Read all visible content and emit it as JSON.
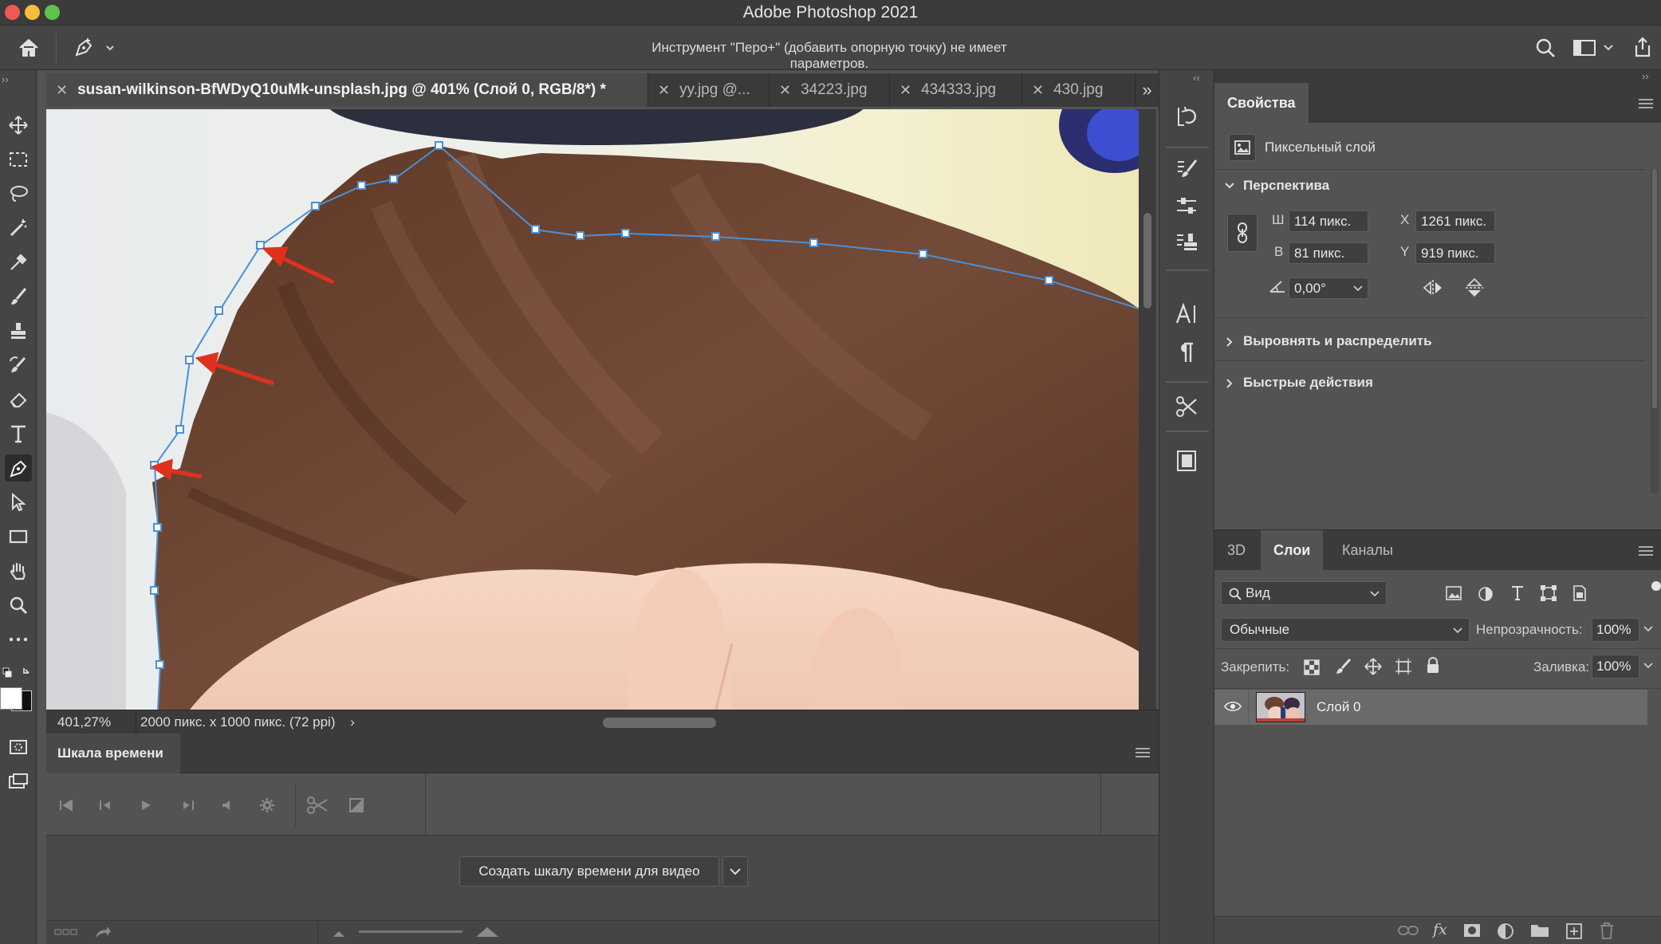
{
  "window": {
    "title": "Adobe Photoshop 2021"
  },
  "options_bar": {
    "message": "Инструмент \"Перо+\" (добавить опорную точку) не имеет параметров."
  },
  "tabs": [
    {
      "label": "susan-wilkinson-BfWDyQ10uMk-unsplash.jpg @ 401% (Слой 0, RGB/8*) *",
      "active": true
    },
    {
      "label": "yy.jpg @...",
      "active": false
    },
    {
      "label": "34223.jpg",
      "active": false
    },
    {
      "label": "434333.jpg",
      "active": false
    },
    {
      "label": "430.jpg",
      "active": false
    }
  ],
  "status": {
    "zoom": "401,27%",
    "doc_info": "2000 пикс. x 1000 пикс. (72 ppi)",
    "chevron": "›"
  },
  "timeline": {
    "title": "Шкала времени",
    "create_button": "Создать шкалу времени для видео"
  },
  "properties": {
    "tab": "Свойства",
    "layer_type": "Пиксельный слой",
    "perspective": {
      "title": "Перспектива",
      "w_label": "Ш",
      "w_value": "114 пикс.",
      "h_label": "В",
      "h_value": "81 пикс.",
      "x_label": "X",
      "x_value": "1261 пикс.",
      "y_label": "Y",
      "y_value": "919 пикс.",
      "angle_value": "0,00°"
    },
    "align_title": "Выровнять и распределить",
    "quick_actions_title": "Быстрые действия"
  },
  "layers_panel": {
    "tabs": [
      "3D",
      "Слои",
      "Каналы"
    ],
    "active_tab": "Слои",
    "filter_label": "Вид",
    "blend_mode": "Обычные",
    "opacity_label": "Непрозрачность:",
    "opacity_value": "100%",
    "lock_label": "Закрепить:",
    "fill_label": "Заливка:",
    "fill_value": "100%",
    "layers": [
      {
        "name": "Слой 0",
        "visible": true
      }
    ]
  },
  "colors": {
    "app_bg": "#535353",
    "panel_dark": "#3b3b3b",
    "path_blue": "#4a90d9",
    "arrow_red": "#e0301e",
    "hair_brown": "#6b4232",
    "skin": "#f1d2c0"
  }
}
